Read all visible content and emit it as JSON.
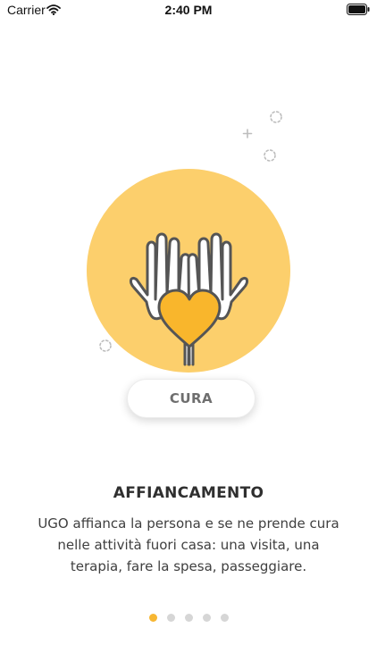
{
  "status_bar": {
    "carrier": "Carrier",
    "time": "2:40 PM",
    "icons": [
      "wifi-icon",
      "battery-icon"
    ]
  },
  "illustration": {
    "icon": "hands-holding-heart-icon",
    "colors": {
      "sun": "#FCCF6C",
      "heart": "#F9B62C",
      "outline": "#555555",
      "sparkle": "#BDBDBD"
    }
  },
  "chip": {
    "label": "CURA"
  },
  "content": {
    "title": "AFFIANCAMENTO",
    "description": "UGO affianca la persona e se ne prende cura nelle attività fuori casa: una visita, una terapia, fare la spesa, passeggiare."
  },
  "pager": {
    "total_pages": 5,
    "current_page": 1,
    "active_color": "#F7B733",
    "inactive_color": "#D6D6D6"
  }
}
